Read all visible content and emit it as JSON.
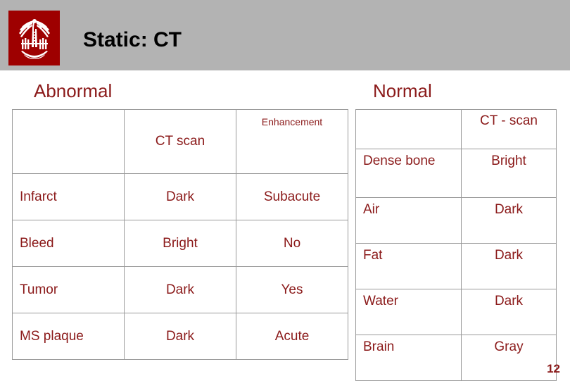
{
  "slide": {
    "title": "Static: CT",
    "page_number": "12",
    "accent_color": "#8B1A1A",
    "logo_color": "#9E0000",
    "header_band_color": "#B3B3B3",
    "logo_icon": "palmetto-tree-crescent-emblem"
  },
  "abnormal": {
    "heading": "Abnormal",
    "columns": [
      "",
      "CT scan",
      "Enhancement"
    ],
    "rows": [
      {
        "label": "Infarct",
        "ct_scan": "Dark",
        "enhancement": "Subacute"
      },
      {
        "label": "Bleed",
        "ct_scan": "Bright",
        "enhancement": "No"
      },
      {
        "label": "Tumor",
        "ct_scan": "Dark",
        "enhancement": "Yes"
      },
      {
        "label": "MS plaque",
        "ct_scan": "Dark",
        "enhancement": "Acute"
      }
    ]
  },
  "normal": {
    "heading": "Normal",
    "columns": [
      "",
      "CT - scan"
    ],
    "rows": [
      {
        "label": "Dense bone",
        "ct_scan": "Bright"
      },
      {
        "label": "Air",
        "ct_scan": "Dark"
      },
      {
        "label": "Fat",
        "ct_scan": "Dark"
      },
      {
        "label": "Water",
        "ct_scan": "Dark"
      },
      {
        "label": "Brain",
        "ct_scan": "Gray"
      }
    ]
  }
}
